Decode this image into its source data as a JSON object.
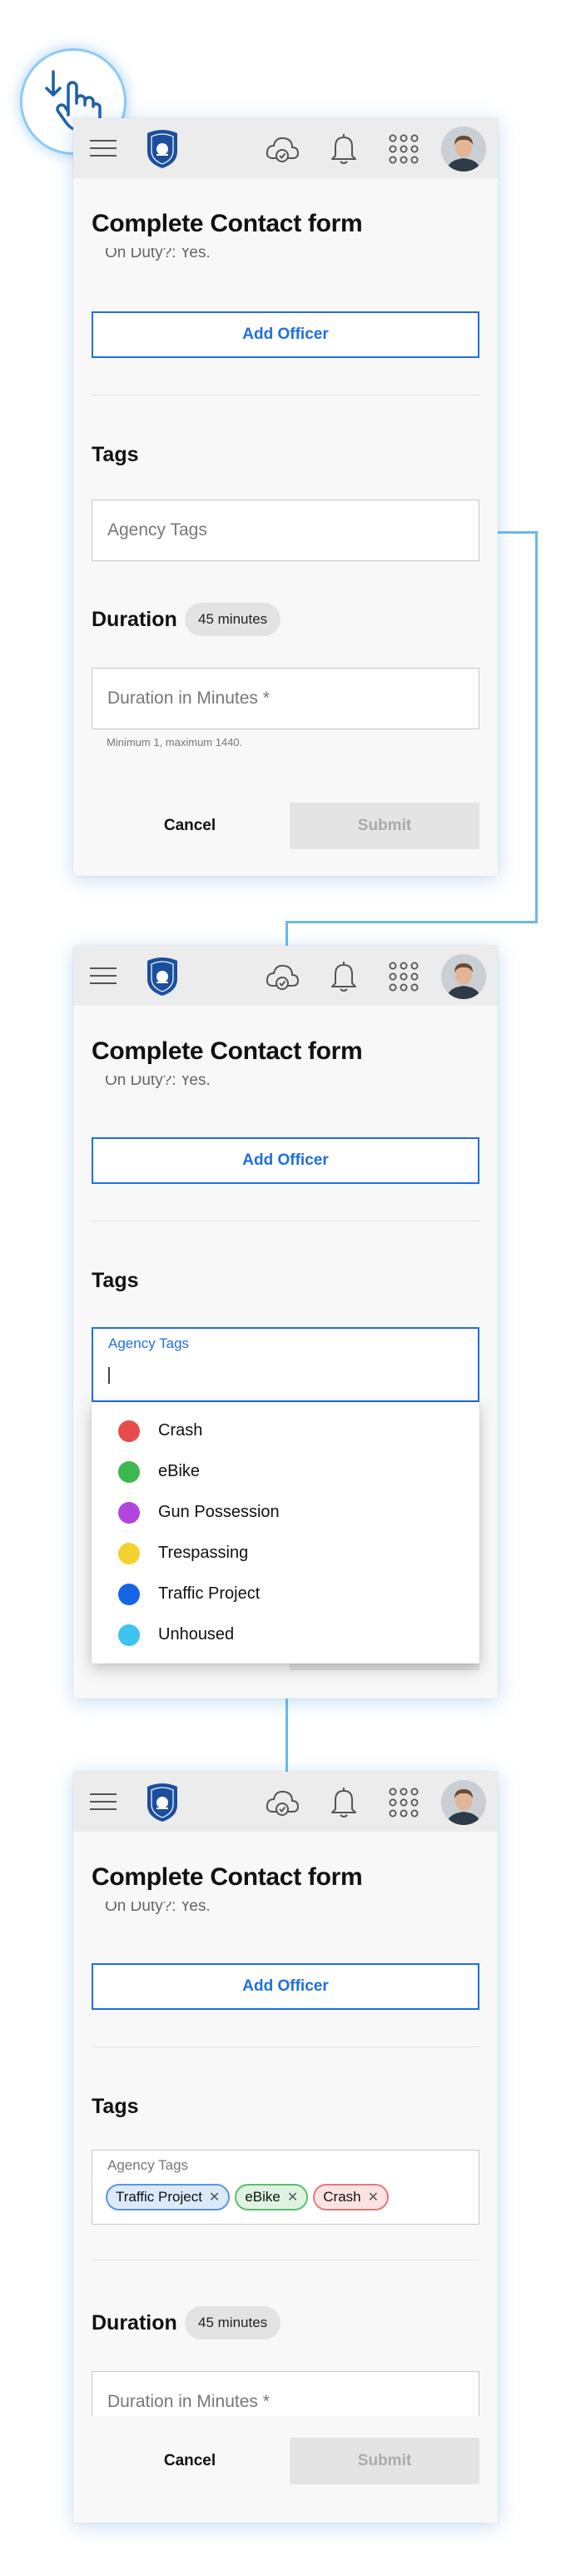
{
  "tap_icon": "tap-hand-icon",
  "colors": {
    "accent": "#1f6fe0",
    "connector": "#6bb8ef",
    "crash": "#e84b4b",
    "ebike": "#3cb84f",
    "gun": "#b046dc",
    "trespassing": "#f2d22e",
    "traffic": "#1565e6",
    "unhoused": "#3fc2ef"
  },
  "screen": {
    "form_title": "Complete Contact form",
    "on_duty": "On Duty?: Yes.",
    "add_officer": "Add Officer",
    "tags_heading": "Tags",
    "agency_tags_placeholder": "Agency Tags",
    "agency_tags_label": "Agency Tags",
    "duration_heading": "Duration",
    "duration_pill": "45 minutes",
    "duration_placeholder": "Duration in Minutes *",
    "duration_hint": "Minimum 1, maximum 1440.",
    "cancel": "Cancel",
    "submit": "Submit"
  },
  "dropdown_options": [
    {
      "label": "Crash",
      "color": "#e84b4b"
    },
    {
      "label": "eBike",
      "color": "#3cb84f"
    },
    {
      "label": "Gun Possession",
      "color": "#b046dc"
    },
    {
      "label": "Trespassing",
      "color": "#f2d22e"
    },
    {
      "label": "Traffic Project",
      "color": "#1565e6"
    },
    {
      "label": "Unhoused",
      "color": "#3fc2ef"
    }
  ],
  "selected_tags": [
    {
      "label": "Traffic Project",
      "bg": "#dbe9fb",
      "border": "#5a93e8"
    },
    {
      "label": "eBike",
      "bg": "#dff3e2",
      "border": "#5bbf6d"
    },
    {
      "label": "Crash",
      "bg": "#fbe3e3",
      "border": "#e27a7a"
    }
  ]
}
